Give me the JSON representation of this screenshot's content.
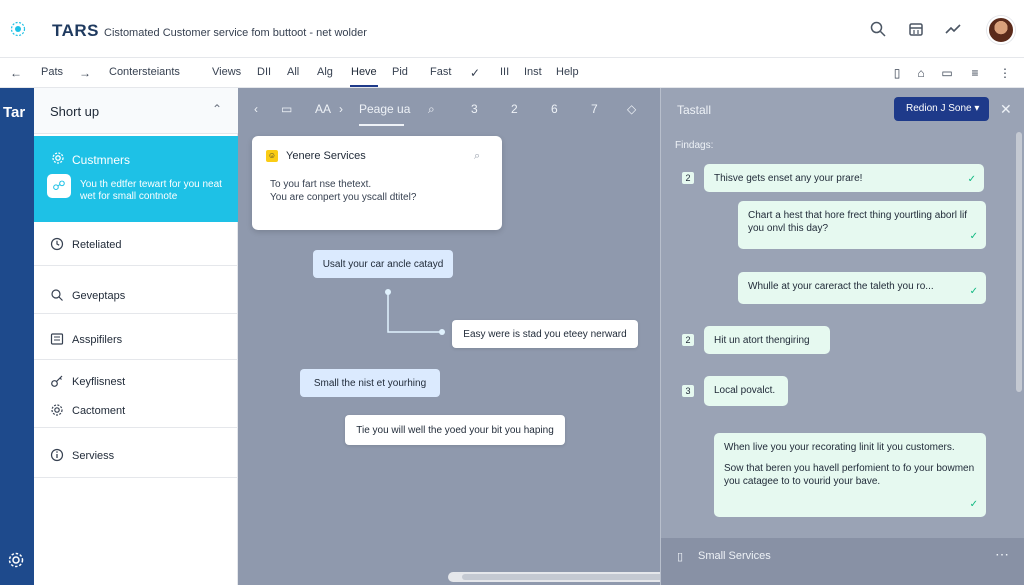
{
  "app": {
    "name": "TARS",
    "subtitle": "Cistomated Customer service fom buttoot - net wolder"
  },
  "menu": {
    "back": "←",
    "items": [
      "Pats",
      "Contersteiants",
      "Views",
      "DII",
      "All",
      "Alg",
      "Heve",
      "Pid",
      "Fast",
      "III",
      "Inst",
      "Help"
    ],
    "active": "Heve"
  },
  "rail": {
    "label": "Tar"
  },
  "sidebar": {
    "title": "Short up",
    "active_item": {
      "title": "Custmners",
      "subtitle": "You th edtfer tewart for you neat wet for small contnote"
    },
    "items": [
      {
        "label": "Reteliated",
        "icon": "clock-icon"
      },
      {
        "label": "Geveptaps",
        "icon": "search-icon"
      },
      {
        "label": "Asspifilers",
        "icon": "list-icon"
      },
      {
        "label": "Keyflisnest",
        "icon": "key-icon"
      },
      {
        "label": "Cactoment",
        "icon": "gear-icon"
      },
      {
        "label": "Serviess",
        "icon": "info-icon"
      }
    ]
  },
  "canvas": {
    "toolbar": [
      "AA",
      "Peage ua",
      "3",
      "2",
      "6",
      "7"
    ],
    "card": {
      "title": "Yenere Services",
      "body_line1": "To you fart nse thetext.",
      "body_line2": "You are conpert you yscall dtitel?"
    },
    "nodes": [
      "Usalt your car ancle catayd",
      "Easy were is stad you eteey nerward",
      "Small the nist et yourhing",
      "Tie you will well the yoed your bit you haping"
    ]
  },
  "right_panel": {
    "title": "Tastall",
    "dropdown": "Redion J Sone",
    "subtitle": "Findags:",
    "messages": [
      {
        "num": "2",
        "text": "Thisve gets enset any your prare!"
      },
      {
        "num": "",
        "text": "Chart a hest that hore frect thing yourtling aborl lif you onvl this day?"
      },
      {
        "num": "",
        "text": "Whulle at your careract the taleth you ro..."
      },
      {
        "num": "2",
        "text": "Hit un atort thengiring"
      },
      {
        "num": "3",
        "text": "Local povalct."
      },
      {
        "num": "",
        "text": "When live you your recorating linit lit you customers.",
        "text2": "Sow that beren you havell perfomient to fo your bowmen you catagee to to vourid your bave."
      }
    ],
    "footer": "Small Services"
  },
  "colors": {
    "accent": "#1ec1e6",
    "brand": "#1e4a8c",
    "button": "#1e3a8a",
    "canvas_bg": "#8f99ad",
    "message_bg": "#e6f9f0"
  }
}
